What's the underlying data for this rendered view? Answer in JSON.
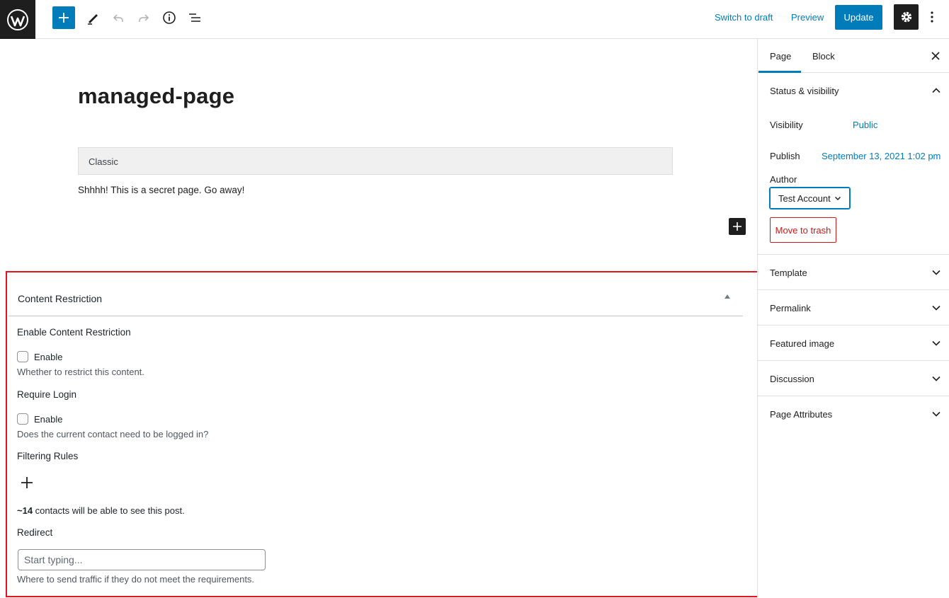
{
  "toolbar": {
    "logo": "wordpress-icon",
    "add_block": "plus-icon",
    "tools": "pencil-icon",
    "undo": "undo-icon",
    "redo": "redo-icon",
    "details": "info-icon",
    "list_view": "list-view-icon",
    "switch_to_draft": "Switch to draft",
    "preview": "Preview",
    "update": "Update",
    "settings": "gear-icon",
    "more": "vertical-ellipsis-icon"
  },
  "editor": {
    "title": "managed-page",
    "classic_block_label": "Classic",
    "paragraph": "Shhhh! This is a secret page. Go away!"
  },
  "content_restriction": {
    "header": "Content Restriction",
    "enable_section": {
      "label": "Enable Content Restriction",
      "checkbox_label": "Enable",
      "checked": false,
      "help": "Whether to restrict this content."
    },
    "login_section": {
      "label": "Require Login",
      "checkbox_label": "Enable",
      "checked": false,
      "help": "Does the current contact need to be logged in?"
    },
    "filtering": {
      "label": "Filtering Rules"
    },
    "contacts": {
      "count": "~14",
      "text": " contacts will be able to see this post."
    },
    "redirect": {
      "label": "Redirect",
      "placeholder": "Start typing...",
      "value": "",
      "help": "Where to send traffic if they do not meet the requirements."
    }
  },
  "sidebar": {
    "tabs": [
      {
        "label": "Page",
        "active": true
      },
      {
        "label": "Block",
        "active": false
      }
    ],
    "status_visibility": {
      "title": "Status & visibility",
      "visibility_label": "Visibility",
      "visibility_value": "Public",
      "publish_label": "Publish",
      "publish_value": "September 13, 2021 1:02 pm",
      "author_label": "Author",
      "author_value": "Test Account",
      "trash": "Move to trash"
    },
    "panels": [
      {
        "title": "Template"
      },
      {
        "title": "Permalink"
      },
      {
        "title": "Featured image"
      },
      {
        "title": "Discussion"
      },
      {
        "title": "Page Attributes"
      }
    ]
  },
  "colors": {
    "accent": "#007cba",
    "dark": "#1e1e1e",
    "danger": "#cc1818",
    "highlight_border": "#e3141e"
  }
}
